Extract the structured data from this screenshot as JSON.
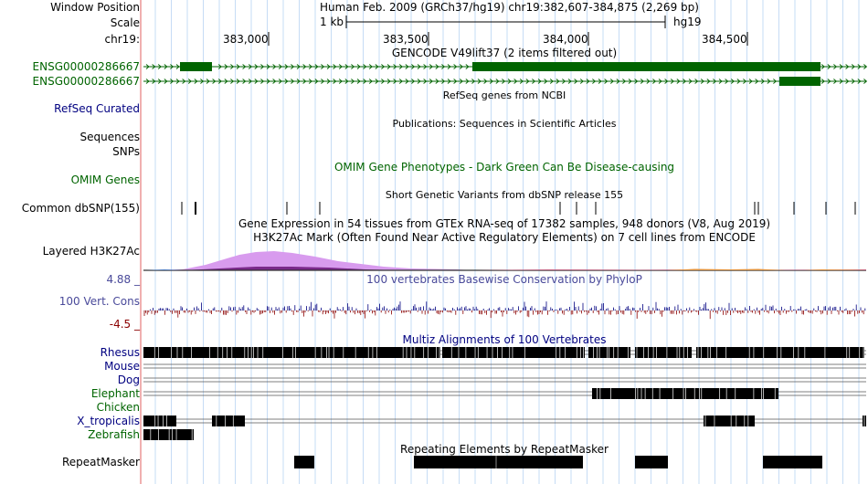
{
  "header": {
    "window_position_label": "Window Position",
    "window_position_value": "Human Feb. 2009 (GRCh37/hg19)   chr19:382,607-384,875 (2,269 bp)",
    "scale_label": "Scale",
    "scale_value": "1 kb",
    "scale_assembly": "hg19",
    "chrom_label": "chr19:",
    "ruler_ticks": [
      "383,000",
      "383,500",
      "384,000",
      "384,500"
    ]
  },
  "tracks": {
    "gencode": {
      "title": "GENCODE V49lift37 (2 items filtered out)",
      "items": [
        "ENSG00000286667",
        "ENSG00000286667"
      ]
    },
    "refseq": {
      "title": "RefSeq genes from NCBI",
      "label": "RefSeq Curated"
    },
    "publications": {
      "title": "Publications: Sequences in Scientific Articles",
      "label": "Sequences"
    },
    "snps": {
      "label": "SNPs"
    },
    "omim": {
      "title": "OMIM Gene Phenotypes - Dark Green Can Be Disease-causing",
      "label": "OMIM Genes"
    },
    "dbsnp": {
      "title": "Short Genetic Variants from dbSNP release 155",
      "label": "Common dbSNP(155)"
    },
    "gtex": {
      "title": "Gene Expression in 54 tissues from GTEx RNA-seq of 17382 samples, 948 donors (V8, Aug 2019)"
    },
    "h3k27ac": {
      "title": "H3K27Ac Mark (Often Found Near Active Regulatory Elements) on 7 cell lines from ENCODE",
      "label": "Layered H3K27Ac"
    },
    "conservation": {
      "title": "100 vertebrates Basewise Conservation by PhyloP",
      "label": "100 Vert. Cons",
      "max": "4.88 _",
      "min": "-4.5 _"
    },
    "multiz": {
      "title": "Multiz Alignments of 100 Vertebrates",
      "species": [
        "Rhesus",
        "Mouse",
        "Dog",
        "Elephant",
        "Chicken",
        "X_tropicalis",
        "Zebrafish"
      ]
    },
    "repeatmasker": {
      "title": "Repeating Elements by RepeatMasker",
      "label": "RepeatMasker"
    }
  },
  "colors": {
    "gene": "#006400",
    "guide_lines": "#c6dcf5",
    "left_border": "#e06060",
    "h3k27ac_fill": "#d89bee",
    "cons_positive": "#000080",
    "cons_negative": "#8b0000",
    "species_label": "#000080"
  }
}
